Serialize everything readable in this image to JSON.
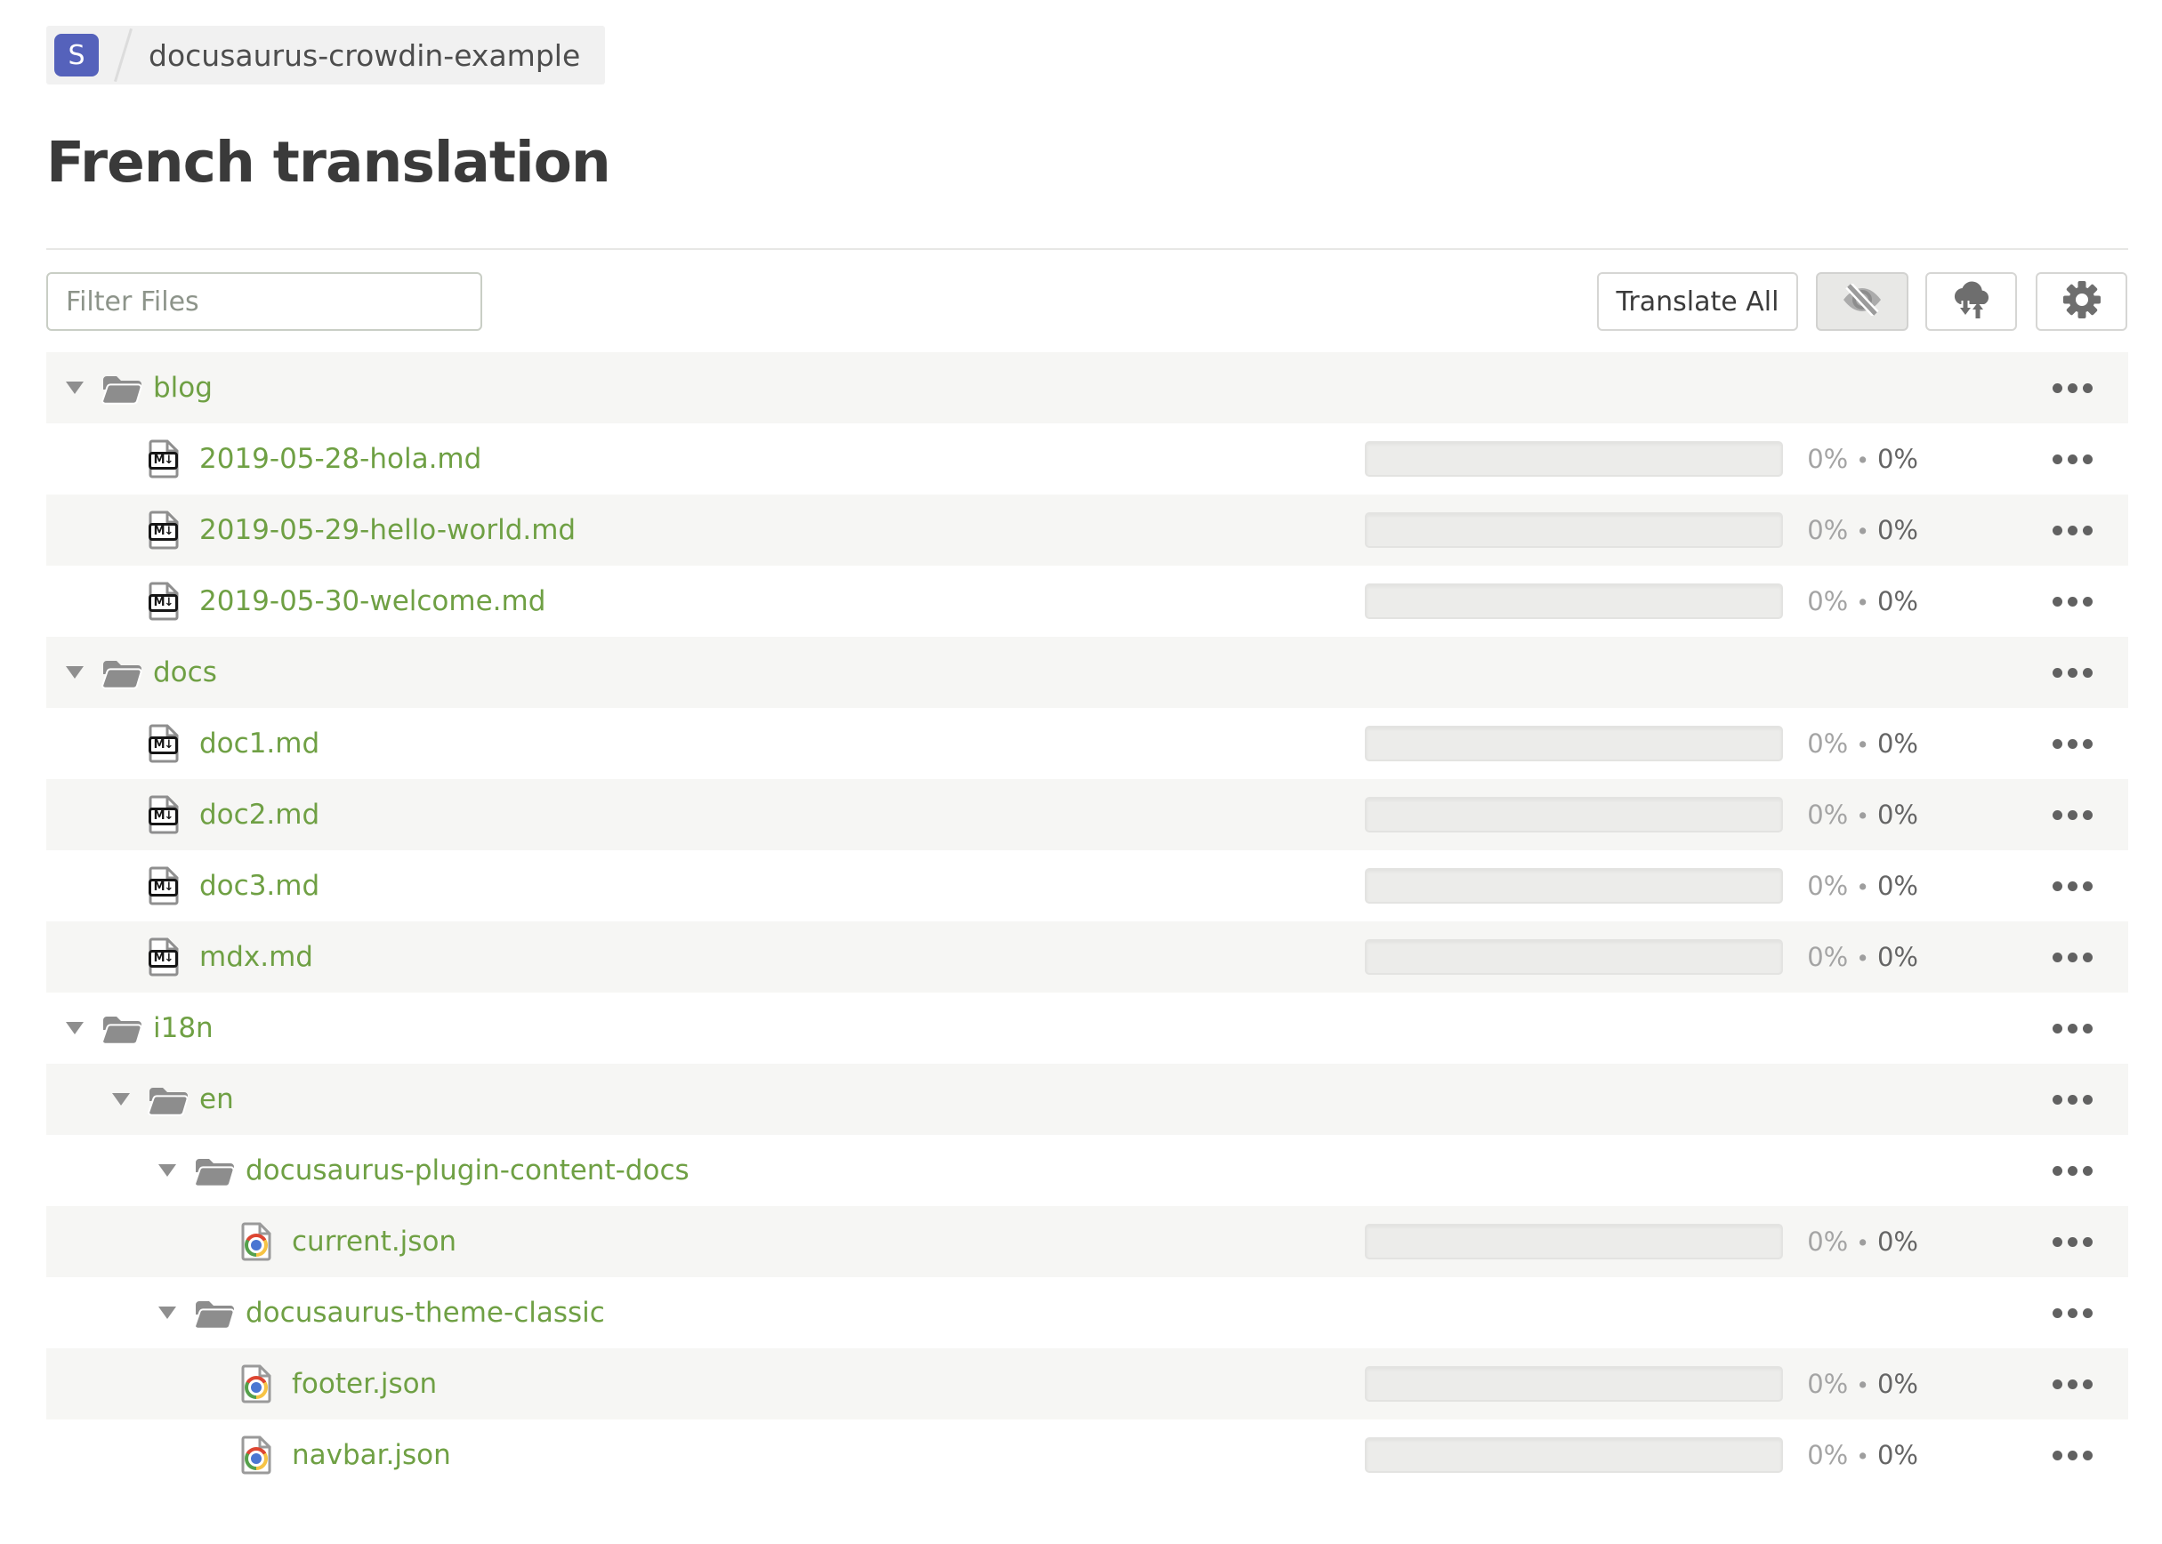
{
  "colors": {
    "accent_green": "#6fa044",
    "badge_indigo": "#5562bb",
    "row_alt_bg": "#f6f6f4",
    "active_button_bg": "#e8e8e6"
  },
  "breadcrumb": {
    "logo_letter": "S",
    "project_name": "docusaurus-crowdin-example"
  },
  "page": {
    "title": "French translation"
  },
  "toolbar": {
    "filter_placeholder": "Filter Files",
    "translate_all_label": "Translate All",
    "icon_buttons": [
      {
        "name": "hidden-files-toggle",
        "icon": "eye-off-icon",
        "active": true
      },
      {
        "name": "sync-files",
        "icon": "cloud-download-upload-icon",
        "active": false
      },
      {
        "name": "settings",
        "icon": "gear-icon",
        "active": false
      }
    ]
  },
  "tree": {
    "percent_separator": "•",
    "rows": [
      {
        "type": "folder",
        "depth": 0,
        "label": "blog",
        "icon": "folder-open-icon"
      },
      {
        "type": "file",
        "depth": 1,
        "label": "2019-05-28-hola.md",
        "icon": "markdown-file-icon",
        "translated": "0%",
        "approved": "0%"
      },
      {
        "type": "file",
        "depth": 1,
        "label": "2019-05-29-hello-world.md",
        "icon": "markdown-file-icon",
        "translated": "0%",
        "approved": "0%"
      },
      {
        "type": "file",
        "depth": 1,
        "label": "2019-05-30-welcome.md",
        "icon": "markdown-file-icon",
        "translated": "0%",
        "approved": "0%"
      },
      {
        "type": "folder",
        "depth": 0,
        "label": "docs",
        "icon": "folder-open-icon"
      },
      {
        "type": "file",
        "depth": 1,
        "label": "doc1.md",
        "icon": "markdown-file-icon",
        "translated": "0%",
        "approved": "0%"
      },
      {
        "type": "file",
        "depth": 1,
        "label": "doc2.md",
        "icon": "markdown-file-icon",
        "translated": "0%",
        "approved": "0%"
      },
      {
        "type": "file",
        "depth": 1,
        "label": "doc3.md",
        "icon": "markdown-file-icon",
        "translated": "0%",
        "approved": "0%"
      },
      {
        "type": "file",
        "depth": 1,
        "label": "mdx.md",
        "icon": "markdown-file-icon",
        "translated": "0%",
        "approved": "0%"
      },
      {
        "type": "folder",
        "depth": 0,
        "label": "i18n",
        "icon": "folder-open-icon"
      },
      {
        "type": "folder",
        "depth": 1,
        "label": "en",
        "icon": "folder-open-icon"
      },
      {
        "type": "folder",
        "depth": 2,
        "label": "docusaurus-plugin-content-docs",
        "icon": "folder-open-icon"
      },
      {
        "type": "file",
        "depth": 3,
        "label": "current.json",
        "icon": "json-file-icon",
        "translated": "0%",
        "approved": "0%"
      },
      {
        "type": "folder",
        "depth": 2,
        "label": "docusaurus-theme-classic",
        "icon": "folder-open-icon"
      },
      {
        "type": "file",
        "depth": 3,
        "label": "footer.json",
        "icon": "json-file-icon",
        "translated": "0%",
        "approved": "0%"
      },
      {
        "type": "file",
        "depth": 3,
        "label": "navbar.json",
        "icon": "json-file-icon",
        "translated": "0%",
        "approved": "0%"
      }
    ]
  }
}
